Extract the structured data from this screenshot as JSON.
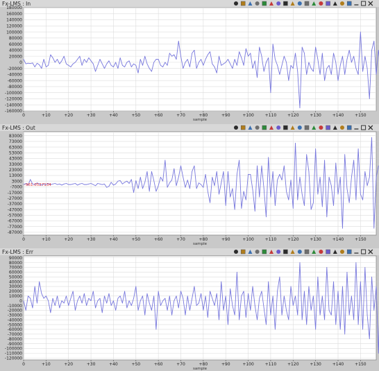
{
  "colors": {
    "background": "#c9c9c9",
    "titlebar": "#d8d8d8",
    "plot_bg": "#ffffff",
    "grid": "#dcdcdc",
    "series": "#7777dd",
    "cursor_label": "#e03030"
  },
  "toolbar_icons": [
    "cursor-icon",
    "hand-icon",
    "zoom-icon",
    "print-icon",
    "prev-icon",
    "play-icon",
    "next-icon",
    "chart-icon",
    "search-icon",
    "zoom-in-icon",
    "zoom-out-icon",
    "fit-icon",
    "grid-icon",
    "table-icon",
    "settings-icon",
    "help-icon",
    "dock-icon",
    "minimize-icon",
    "restore-icon",
    "close-icon"
  ],
  "chart_data": [
    {
      "type": "line",
      "title": "Fx-LMS : In",
      "xlabel": "sample",
      "ylabel": "",
      "xlim": [
        0,
        157
      ],
      "ylim": [
        -160000,
        180000
      ],
      "x_ticks": [
        0,
        10,
        20,
        30,
        40,
        50,
        60,
        70,
        80,
        90,
        100,
        110,
        120,
        130,
        140,
        150
      ],
      "x_tick_labels": [
        "0",
        "+10",
        "+20",
        "+30",
        "+40",
        "+50",
        "+60",
        "+70",
        "+80",
        "+90",
        "+100",
        "+110",
        "+120",
        "+130",
        "+140",
        "+150"
      ],
      "y_ticks": [
        180000,
        160000,
        140000,
        120000,
        100000,
        80000,
        60000,
        40000,
        20000,
        0,
        -20000,
        -40000,
        -60000,
        -80000,
        -100000,
        -120000,
        -140000,
        -160000
      ],
      "y_tick_labels": [
        "180000",
        "160000",
        "140000",
        "120000",
        "100000",
        "80000",
        "60000",
        "40000",
        "20000",
        "0",
        "-20000",
        "-40000",
        "-60000",
        "-80000",
        "-100000",
        "-120000",
        "-140000",
        "-160000"
      ],
      "grid": true,
      "series": [
        {
          "values": [
            10000,
            -5000,
            -3000,
            -4000,
            -2000,
            -15000,
            -3000,
            -8000,
            -20000,
            10000,
            -15000,
            -10000,
            25000,
            15000,
            0,
            10000,
            -5000,
            5000,
            20000,
            -5000,
            -10000,
            -15000,
            -5000,
            0,
            10000,
            20000,
            -10000,
            10000,
            0,
            15000,
            5000,
            -5000,
            -30000,
            -10000,
            10000,
            -5000,
            -20000,
            -5000,
            5000,
            -10000,
            -15000,
            0,
            -20000,
            15000,
            -10000,
            -15000,
            0,
            5000,
            -15000,
            -5000,
            -10000,
            -35000,
            10000,
            -10000,
            20000,
            -5000,
            -20000,
            -30000,
            0,
            10000,
            10000,
            -10000,
            -15000,
            0,
            -10000,
            30000,
            20000,
            25000,
            10000,
            70000,
            20000,
            -20000,
            0,
            10000,
            -15000,
            30000,
            40000,
            -20000,
            0,
            10000,
            -10000,
            10000,
            25000,
            35000,
            -5000,
            -15000,
            -35000,
            20000,
            -10000,
            -5000,
            0,
            10000,
            -5000,
            -20000,
            10000,
            -10000,
            35000,
            15000,
            -10000,
            45000,
            20000,
            30000,
            -20000,
            5000,
            -50000,
            50000,
            20000,
            -30000,
            0,
            15000,
            -100000,
            60000,
            10000,
            -10000,
            -40000,
            -10000,
            20000,
            0,
            -60000,
            -10000,
            -20000,
            30000,
            -30000,
            -150000,
            50000,
            30000,
            -40000,
            0,
            -20000,
            -30000,
            50000,
            10000,
            -40000,
            30000,
            -60000,
            -20000,
            -10000,
            -40000,
            30000,
            0,
            -60000,
            -10000,
            20000,
            -40000,
            10000,
            40000,
            0,
            20000,
            -20000,
            -40000,
            100000,
            -30000,
            20000,
            -20000,
            -120000,
            40000,
            70000,
            -40000,
            40000,
            -20000,
            -30000
          ]
        }
      ]
    },
    {
      "type": "line",
      "title": "Fx-LMS : Out",
      "xlabel": "sample",
      "ylabel": "",
      "xlim": [
        0,
        157
      ],
      "ylim": [
        -92000,
        90000
      ],
      "x_ticks": [
        0,
        10,
        20,
        30,
        40,
        50,
        60,
        70,
        80,
        90,
        100,
        110,
        120,
        130,
        140,
        150
      ],
      "x_tick_labels": [
        "0",
        "+10",
        "+20",
        "+30",
        "+40",
        "+50",
        "+60",
        "+70",
        "+80",
        "+90",
        "+100",
        "+110",
        "+120",
        "+130",
        "+140",
        "+150"
      ],
      "y_ticks": [
        83000,
        73000,
        63000,
        53000,
        43000,
        33000,
        23000,
        13000,
        3000,
        -7000,
        -17000,
        -27000,
        -37000,
        -47000,
        -57000,
        -67000,
        -77000,
        -87000
      ],
      "y_tick_labels": [
        "83000",
        "73000",
        "63000",
        "53000",
        "43000",
        "33000",
        "23000",
        "13000",
        "3000",
        "-7000",
        "-17000",
        "-27000",
        "-37000",
        "-47000",
        "-57000",
        "-67000",
        "-77000",
        "-87000"
      ],
      "annotations": [
        {
          "x": 0,
          "y": -3000,
          "text": "-961.0527134"
        }
      ],
      "grid": true,
      "series": [
        {
          "values": [
            -3000,
            -1000,
            -4000,
            6000,
            -2000,
            -3000,
            0,
            -2000,
            -4000,
            -2000,
            -3000,
            -1000,
            -3000,
            -2000,
            -1000,
            -3000,
            -2000,
            -4000,
            -2000,
            -1000,
            -3000,
            -3000,
            -2000,
            -1000,
            -4000,
            -2000,
            -1000,
            -3000,
            -3000,
            -2000,
            -1000,
            -3000,
            -5000,
            -1000,
            -2000,
            -3000,
            -2000,
            -8000,
            -6000,
            1000,
            -4000,
            -2000,
            3000,
            4000,
            -2000,
            1000,
            3000,
            -1000,
            6000,
            -17000,
            4000,
            -10000,
            10000,
            -10000,
            1000,
            20000,
            -15000,
            20000,
            4000,
            -15000,
            -5000,
            10000,
            3000,
            40000,
            -8000,
            0,
            5000,
            25000,
            -5000,
            10000,
            30000,
            10000,
            -8000,
            5000,
            -10000,
            20000,
            30000,
            -10000,
            0,
            -3000,
            -8000,
            15000,
            -15000,
            -35000,
            10000,
            -5000,
            20000,
            -20000,
            0,
            20000,
            -40000,
            20000,
            -25000,
            -10000,
            -47000,
            15000,
            40000,
            -45000,
            -15000,
            -30000,
            15000,
            15000,
            -12000,
            -50000,
            30000,
            -25000,
            30000,
            -10000,
            -60000,
            45000,
            -25000,
            20000,
            -40000,
            5000,
            15000,
            5000,
            30000,
            -15000,
            -30000,
            5000,
            -45000,
            70000,
            -30000,
            10000,
            -20000,
            -40000,
            50000,
            20000,
            -47000,
            -35000,
            60000,
            -20000,
            10000,
            -42000,
            40000,
            -60000,
            10000,
            -5000,
            -40000,
            35000,
            -20000,
            10000,
            -80000,
            50000,
            -10000,
            -35000,
            10000,
            40000,
            -30000,
            60000,
            -20000,
            -30000,
            20000,
            -5000,
            10000,
            80000,
            -80000,
            10000,
            30000
          ]
        }
      ]
    },
    {
      "type": "line",
      "title": "Fx-LMS : Err",
      "xlabel": "sample",
      "ylabel": "",
      "xlim": [
        0,
        157
      ],
      "ylim": [
        -124000,
        94000
      ],
      "x_ticks": [
        0,
        10,
        20,
        30,
        40,
        50,
        60,
        70,
        80,
        90,
        100,
        110,
        120,
        130,
        140,
        150
      ],
      "x_tick_labels": [
        "0",
        "+10",
        "+20",
        "+30",
        "+40",
        "+50",
        "+60",
        "+70",
        "+80",
        "+90",
        "+100",
        "+110",
        "+120",
        "+130",
        "+140",
        "+150"
      ],
      "y_ticks": [
        90000,
        80000,
        70000,
        60000,
        50000,
        40000,
        30000,
        20000,
        10000,
        0,
        -10000,
        -20000,
        -30000,
        -40000,
        -50000,
        -60000,
        -70000,
        -80000,
        -90000,
        -100000,
        -110000,
        -120000
      ],
      "y_tick_labels": [
        "90000",
        "80000",
        "70000",
        "60000",
        "50000",
        "40000",
        "30000",
        "20000",
        "10000",
        "0",
        "-10000",
        "-20000",
        "-30000",
        "-40000",
        "-50000",
        "-60000",
        "-70000",
        "-80000",
        "-90000",
        "-100000",
        "-110000",
        "-120000"
      ],
      "grid": true,
      "series": [
        {
          "values": [
            0,
            -20000,
            10000,
            5000,
            -15000,
            30000,
            -5000,
            40000,
            15000,
            5000,
            10000,
            0,
            -25000,
            5000,
            -10000,
            10000,
            -15000,
            0,
            -5000,
            10000,
            -10000,
            5000,
            20000,
            -20000,
            0,
            10000,
            -5000,
            15000,
            -10000,
            5000,
            0,
            20000,
            -15000,
            0,
            5000,
            -25000,
            10000,
            -5000,
            15000,
            -10000,
            0,
            -20000,
            5000,
            10000,
            -5000,
            20000,
            -15000,
            0,
            -10000,
            5000,
            30000,
            -20000,
            0,
            10000,
            -30000,
            15000,
            -5000,
            -20000,
            10000,
            -60000,
            20000,
            -10000,
            0,
            5000,
            -20000,
            10000,
            -30000,
            0,
            10000,
            -15000,
            20000,
            5000,
            -30000,
            10000,
            -20000,
            5000,
            30000,
            -10000,
            -5000,
            15000,
            -20000,
            10000,
            -35000,
            20000,
            5000,
            -10000,
            15000,
            -40000,
            40000,
            -20000,
            10000,
            -50000,
            25000,
            -10000,
            -30000,
            60000,
            -40000,
            10000,
            20000,
            -35000,
            15000,
            -20000,
            30000,
            -10000,
            -40000,
            5000,
            20000,
            -15000,
            -50000,
            40000,
            -30000,
            10000,
            -60000,
            20000,
            50000,
            -30000,
            10000,
            -20000,
            -40000,
            30000,
            -10000,
            10000,
            -30000,
            80000,
            -40000,
            20000,
            -50000,
            30000,
            -20000,
            10000,
            -60000,
            50000,
            -30000,
            10000,
            -40000,
            70000,
            -20000,
            -30000,
            40000,
            -50000,
            20000,
            -60000,
            30000,
            -70000,
            60000,
            -30000,
            10000,
            -40000,
            80000,
            -50000,
            40000,
            -60000,
            70000,
            -30000,
            -80000,
            50000,
            -20000,
            30000,
            -110000,
            60000,
            -30000
          ]
        }
      ]
    }
  ]
}
